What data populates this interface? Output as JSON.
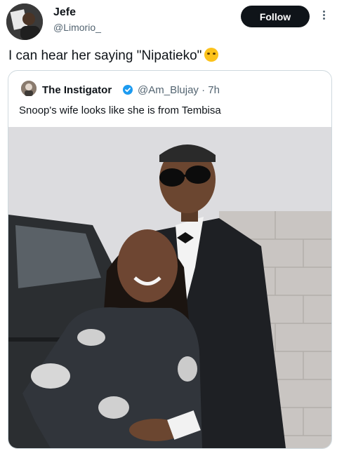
{
  "author": {
    "name": "Jefe",
    "handle": "@Limorio_"
  },
  "follow_label": "Follow",
  "tweet_text": "I can hear her saying \"Nipatieko\"",
  "emoji": "loudly-crying-face-icon",
  "quote": {
    "name": "The Instigator",
    "verified": true,
    "handle": "@Am_Blujay",
    "time": "· 7h",
    "text": "Snoop's wife looks like she is from Tembisa"
  },
  "colors": {
    "follow_bg": "#0f1419",
    "secondary_text": "#536471",
    "verified_blue": "#1d9bf0",
    "border": "#cfd9de"
  }
}
